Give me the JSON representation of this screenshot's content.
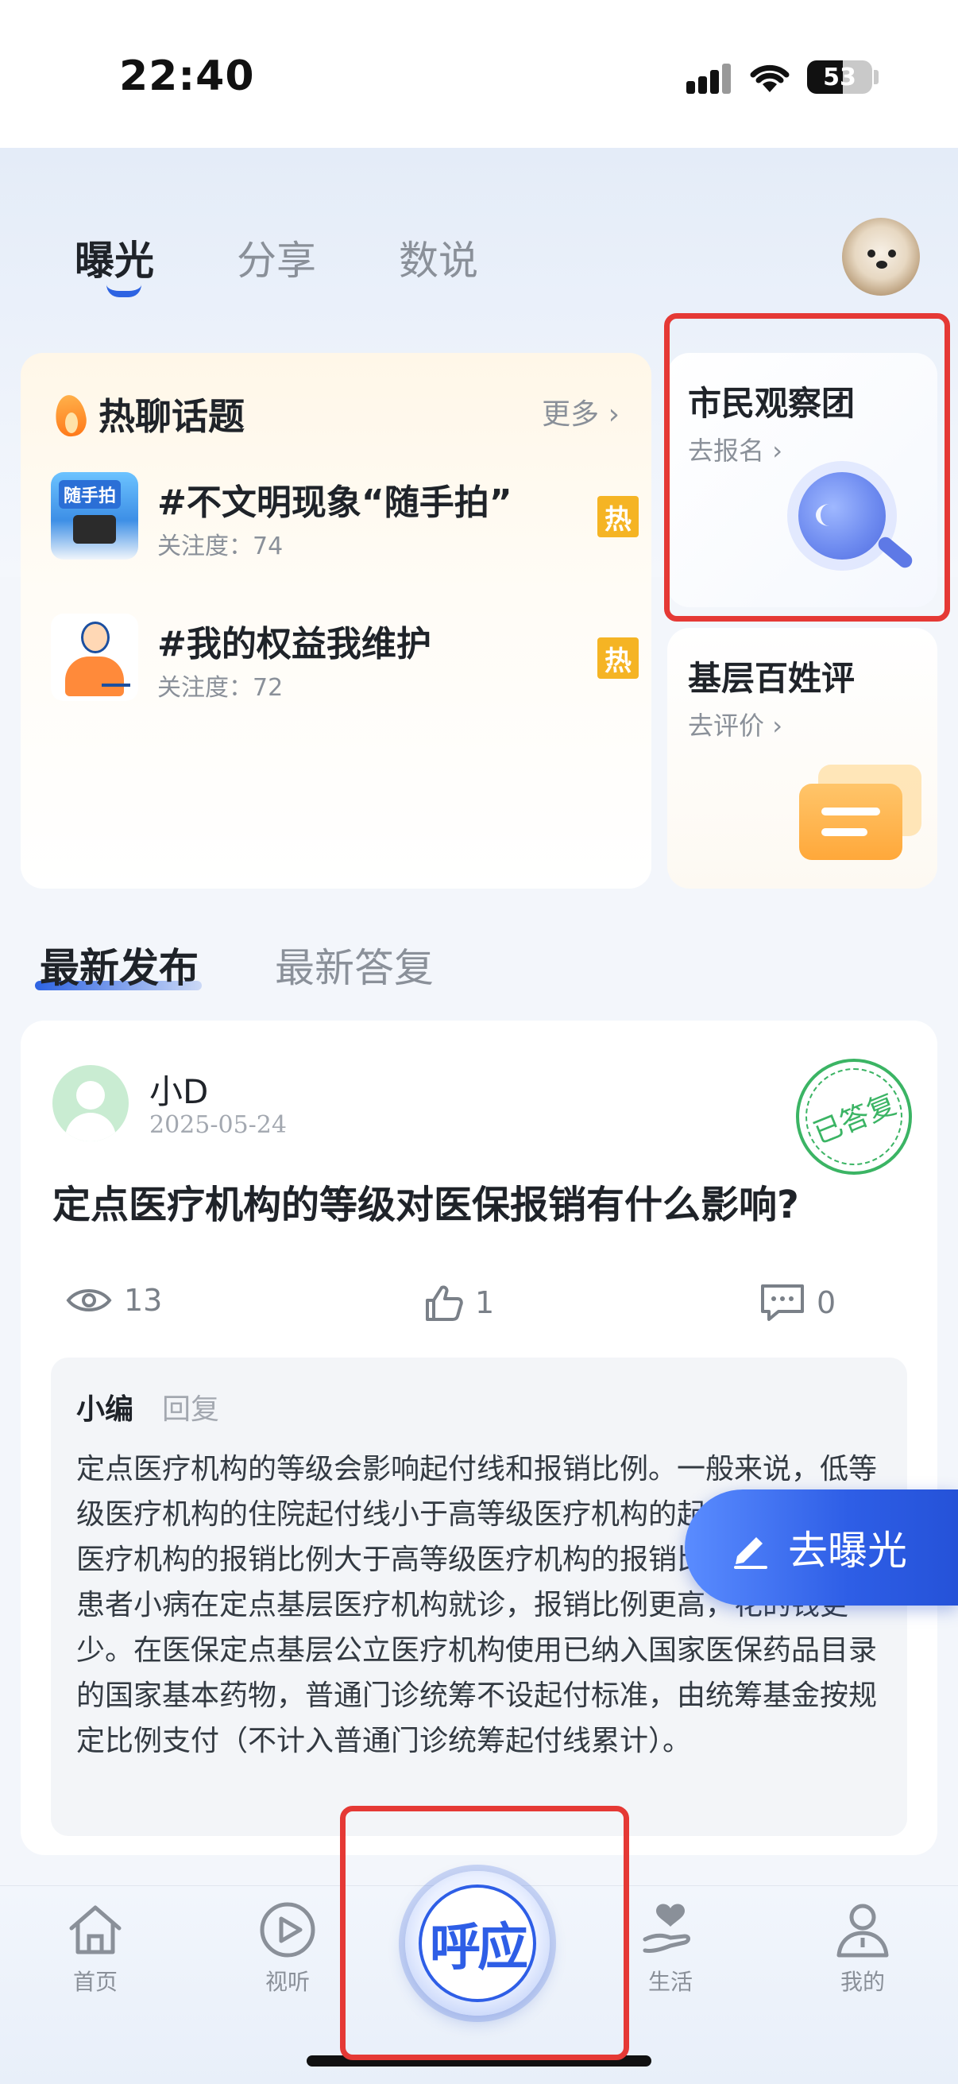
{
  "status_bar": {
    "time": "22:40",
    "battery": "53"
  },
  "top_tabs": [
    {
      "label": "曝光",
      "active": true
    },
    {
      "label": "分享",
      "active": false
    },
    {
      "label": "数说",
      "active": false
    }
  ],
  "hot_topics": {
    "title": "热聊话题",
    "more_label": "更多",
    "items": [
      {
        "name": "#不文明现象“随手拍”",
        "meta": "关注度：74",
        "badge": "热",
        "thumb_label": "随手拍"
      },
      {
        "name": "#我的权益我维护",
        "meta": "关注度：72",
        "badge": "热"
      }
    ]
  },
  "side_cards": {
    "citizen": {
      "title": "市民观察团",
      "sub": "去报名"
    },
    "grassroots": {
      "title": "基层百姓评",
      "sub": "去评价"
    }
  },
  "section_tabs": [
    {
      "label": "最新发布",
      "active": true
    },
    {
      "label": "最新答复",
      "active": false
    }
  ],
  "post": {
    "username": "小D",
    "date": "2025-05-24",
    "stamp": "已答复",
    "title": "定点医疗机构的等级对医保报销有什么影响?",
    "views": "13",
    "likes": "1",
    "comments": "0",
    "reply": {
      "author": "小编",
      "label": "回复",
      "text": "定点医疗机构的等级会影响起付线和报销比例。一般来说，低等级医疗机构的住院起付线小于高等级医疗机构的起付线，低等级医疗机构的报销比例大于高等级医疗机构的报销比例。国家鼓励患者小病在定点基层医疗机构就诊，报销比例更高，花的钱更少。在医保定点基层公立医疗机构使用已纳入国家医保药品目录的国家基本药物，普通门诊统筹不设起付标准，由统筹基金按规定比例支付（不计入普通门诊统筹起付线累计）。"
    }
  },
  "fab": {
    "label": "去曝光"
  },
  "bottom_nav": {
    "items": [
      {
        "label": "首页",
        "icon": "home-icon"
      },
      {
        "label": "视听",
        "icon": "play-icon"
      },
      {
        "label": "生活",
        "icon": "heart-hand-icon"
      },
      {
        "label": "我的",
        "icon": "person-icon"
      }
    ],
    "center_label": "呼应"
  },
  "colors": {
    "accent": "#2e5ee6",
    "hot_badge": "#f5b424",
    "stamp": "#3bb464",
    "highlight": "#e53935"
  }
}
